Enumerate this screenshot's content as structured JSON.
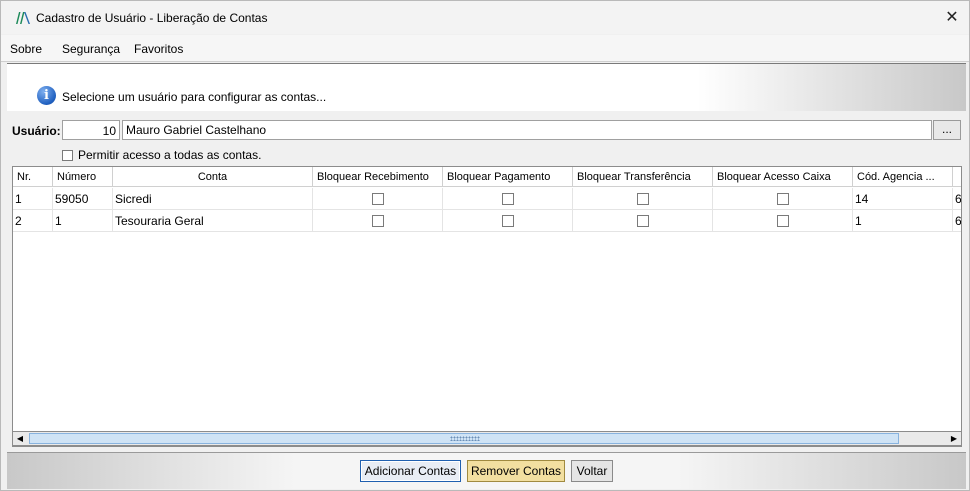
{
  "window": {
    "title": "Cadastro de Usuário - Liberação de Contas",
    "close_glyph": "✕"
  },
  "menu": [
    "Sobre",
    "Segurança",
    "Favoritos"
  ],
  "banner": {
    "icon": "info-icon",
    "text": "Selecione um usuário para configurar as contas..."
  },
  "user": {
    "label": "Usuário:",
    "id": "10",
    "name": "Mauro Gabriel Castelhano",
    "lookup_label": "..."
  },
  "permit_all": {
    "label": "Permitir acesso a todas as contas.",
    "checked": false
  },
  "grid": {
    "columns": [
      "Nr.",
      "Número",
      "Conta",
      "Bloquear Recebimento",
      "Bloquear Pagamento",
      "Bloquear Transferência",
      "Bloquear Acesso Caixa",
      "Cód. Agencia ..."
    ],
    "rows": [
      {
        "nr": "1",
        "numero": "59050",
        "conta": "Sicredi",
        "cod_agencia": "14",
        "extra": "6"
      },
      {
        "nr": "2",
        "numero": "1",
        "conta": "Tesouraria Geral",
        "cod_agencia": "1",
        "extra": "6"
      }
    ]
  },
  "buttons": {
    "add": "Adicionar Contas",
    "remove": "Remover Contas",
    "back": "Voltar"
  },
  "colors": {
    "remove_button": "#f2dfa0",
    "info_icon": "#1f5fbf"
  }
}
